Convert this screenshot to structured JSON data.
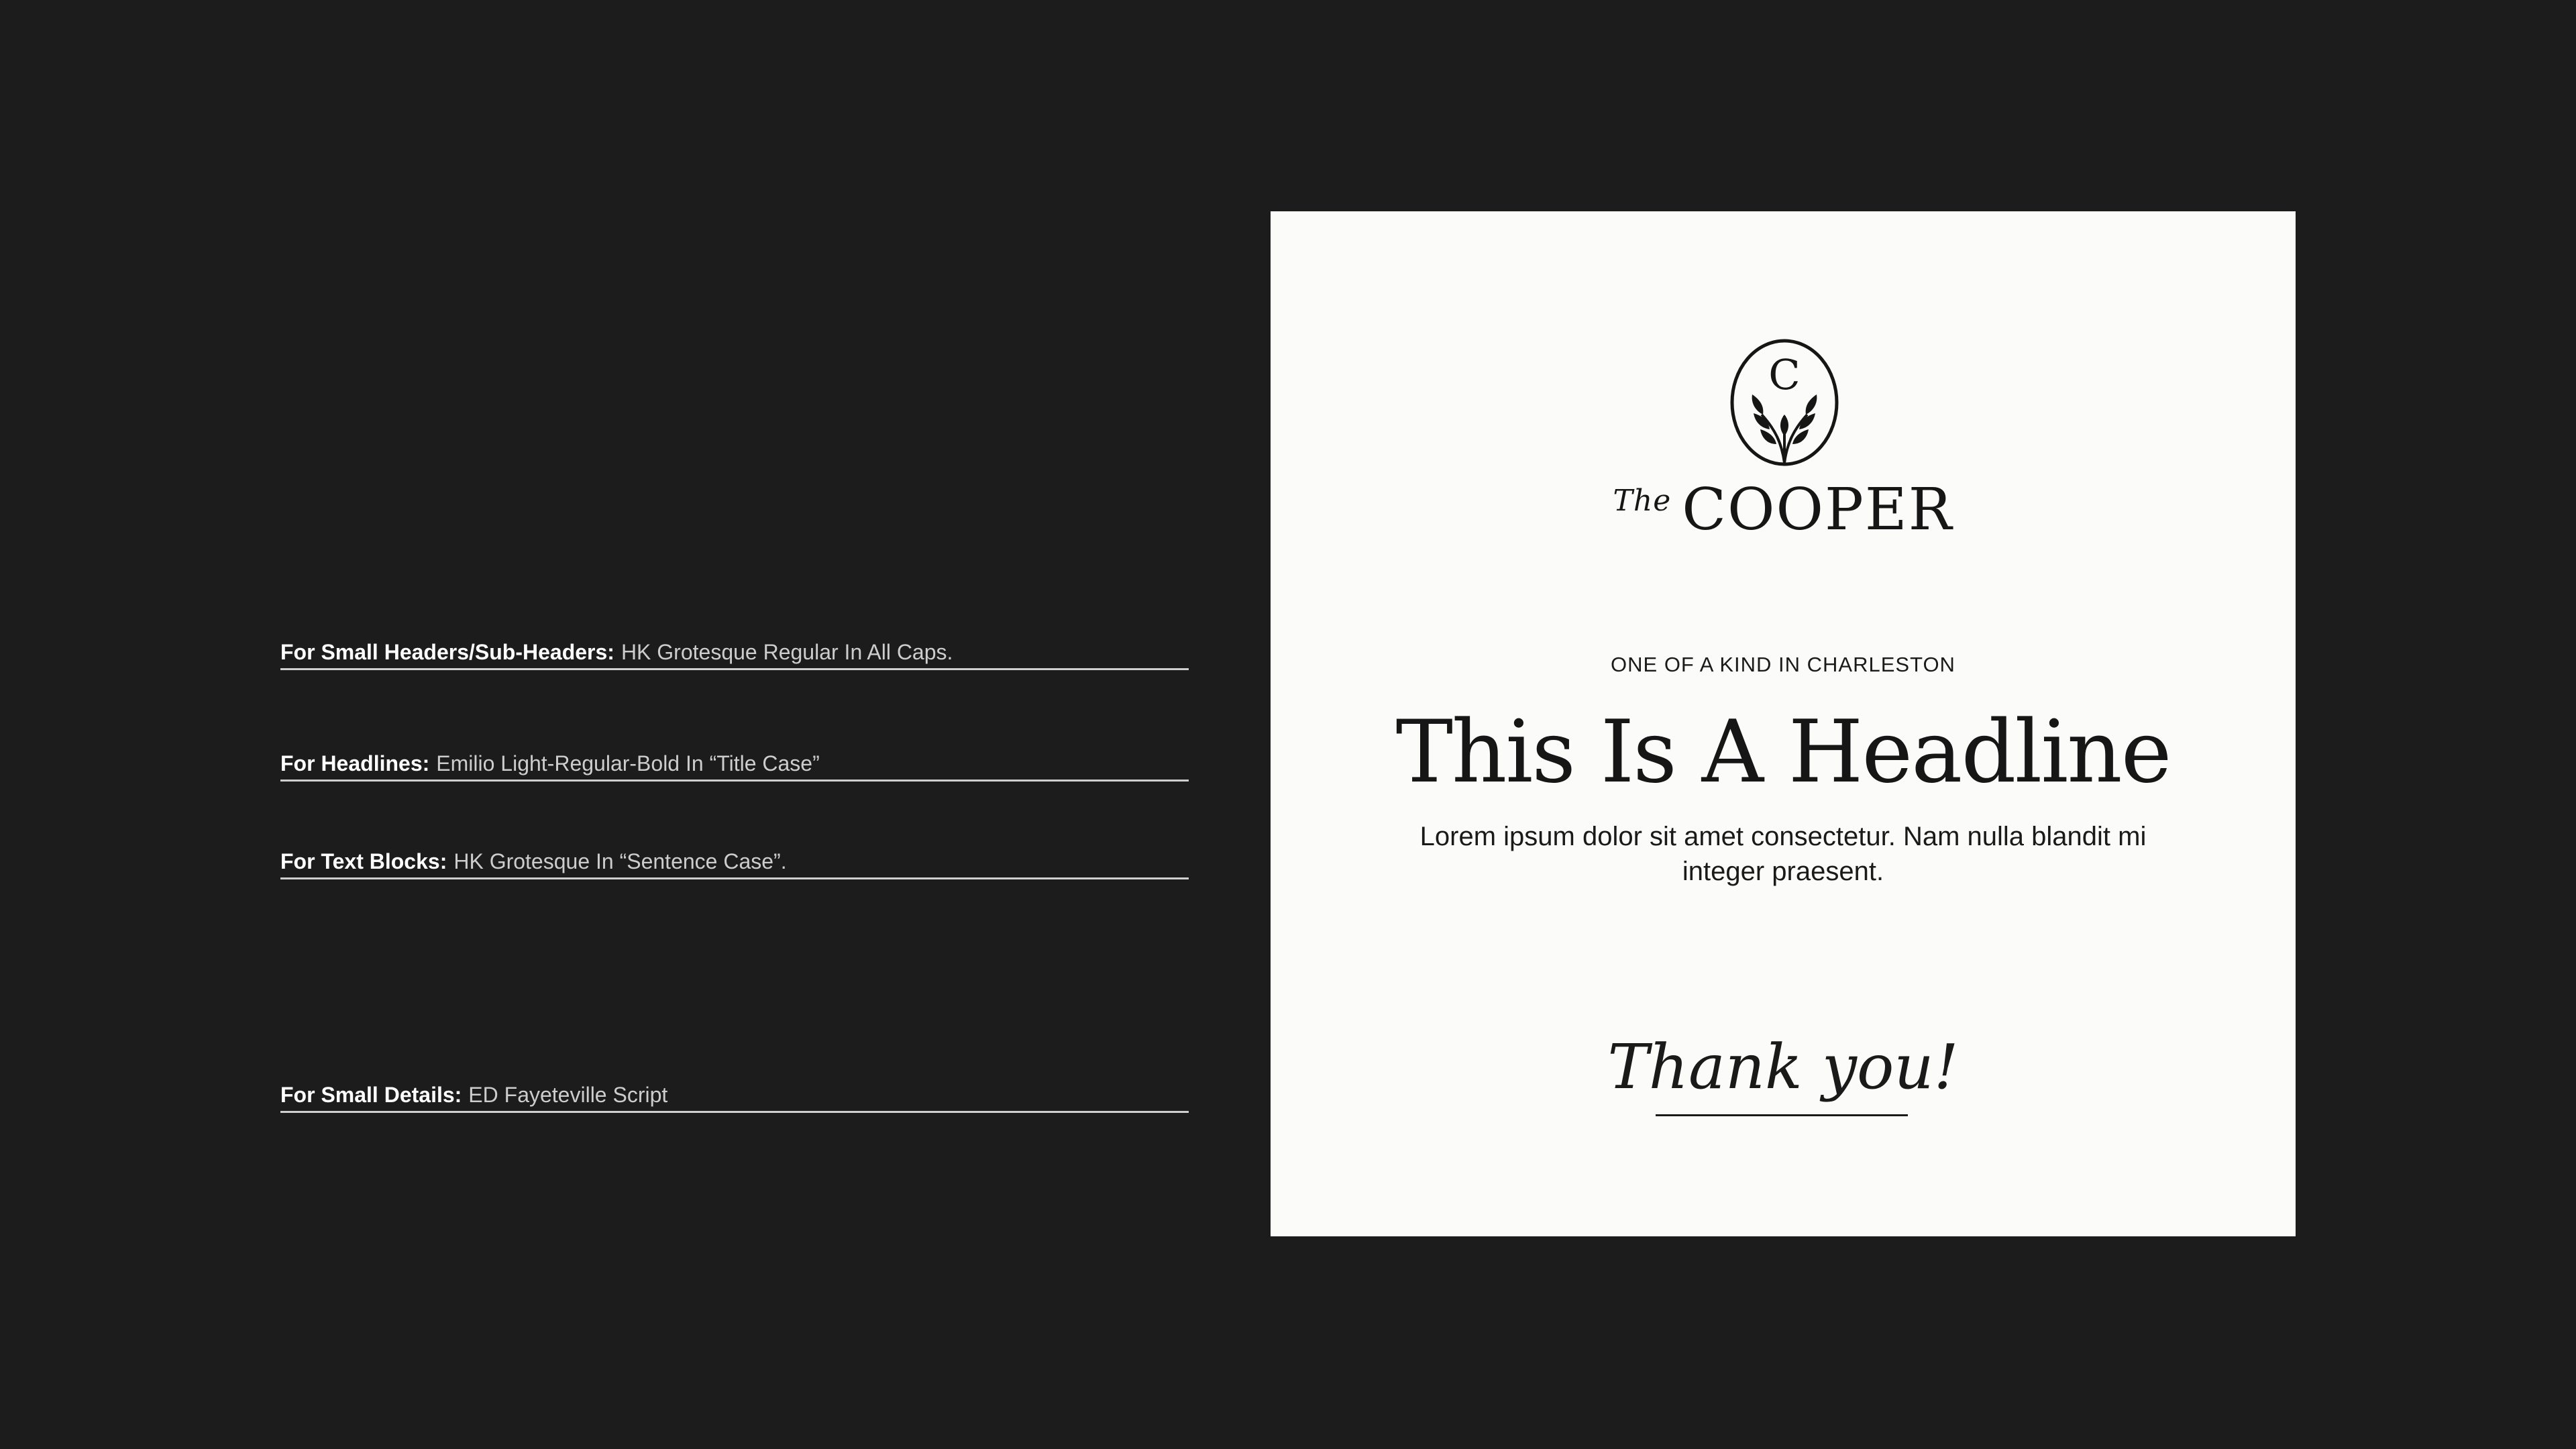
{
  "specs": [
    {
      "label": "For Small Headers/Sub-Headers:",
      "description": "HK Grotesque Regular In All Caps."
    },
    {
      "label": "For Headlines:",
      "description": "Emilio Light-Regular-Bold  In “Title Case”"
    },
    {
      "label": "For Text Blocks:",
      "description": "HK Grotesque In “Sentence Case”."
    },
    {
      "label": "For Small Details:",
      "description": "ED Fayeteville Script"
    }
  ],
  "card": {
    "logo": {
      "monogram": "C",
      "prefix": "The",
      "name": "COOPER"
    },
    "eyebrow": "ONE OF A KIND IN CHARLESTON",
    "headline": "This Is A Headline",
    "body": "Lorem ipsum dolor sit amet consectetur. Nam nulla blandit mi integer praesent.",
    "signature": "Thank you!"
  },
  "colors": {
    "background": "#1c1c1c",
    "card": "#fbfbf9",
    "ink": "#161616",
    "rule": "#cfcfcf"
  },
  "icons": [
    "wheat-monogram-icon"
  ]
}
